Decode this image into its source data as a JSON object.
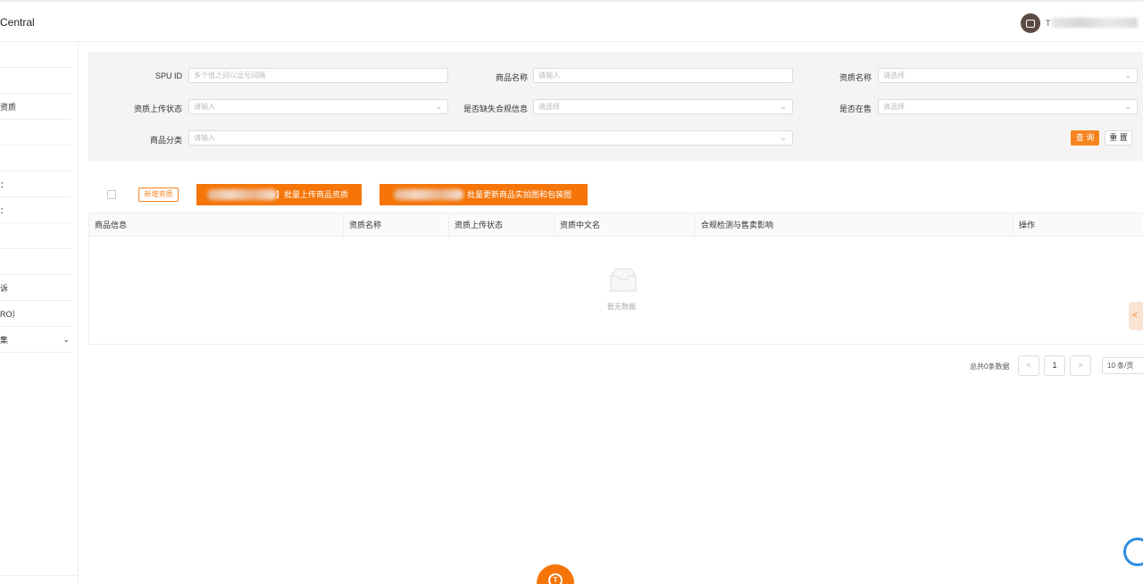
{
  "header": {
    "brand": "Central",
    "user_name_initial": "T"
  },
  "sidebar": {
    "items": [
      {
        "label": ""
      },
      {
        "label": ""
      },
      {
        "label": "资质"
      },
      {
        "label": ""
      },
      {
        "label": ""
      },
      {
        "label": "："
      },
      {
        "label": "："
      },
      {
        "label": ""
      },
      {
        "label": ""
      },
      {
        "label": "诉"
      },
      {
        "label": "RO）"
      },
      {
        "label": "集"
      }
    ]
  },
  "filters": {
    "spu_id": {
      "label": "SPU ID",
      "placeholder": "多个值之间以逗号间隔"
    },
    "product_name": {
      "label": "商品名称",
      "placeholder": "请输入"
    },
    "qualification_name": {
      "label": "资质名称",
      "placeholder": "请选择"
    },
    "upload_status": {
      "label": "资质上传状态",
      "placeholder": "请输入"
    },
    "missing_compliance": {
      "label": "是否缺失合规信息",
      "placeholder": "请选择"
    },
    "on_sale": {
      "label": "是否在售",
      "placeholder": "请选择"
    },
    "category": {
      "label": "商品分类",
      "placeholder": "请输入"
    },
    "query_label": "查 询",
    "reset_label": "重 置"
  },
  "actions": {
    "new_label": "新增资质",
    "bulk_upload_label": "】批量上传商品资质",
    "bulk_update_label": "批量更新商品实拍图和包装图"
  },
  "table": {
    "columns": [
      "商品信息",
      "资质名称",
      "资质上传状态",
      "资质中文名",
      "合规检测与售卖影响",
      "操作"
    ],
    "empty_text": "暂无数据"
  },
  "pagination": {
    "total_text": "总共0条数据",
    "prev": "<",
    "current_page": "1",
    "next": ">",
    "page_size": "10 条/页"
  },
  "float": {
    "side_tab_arrow": "<",
    "bottom_glyph": "T"
  }
}
